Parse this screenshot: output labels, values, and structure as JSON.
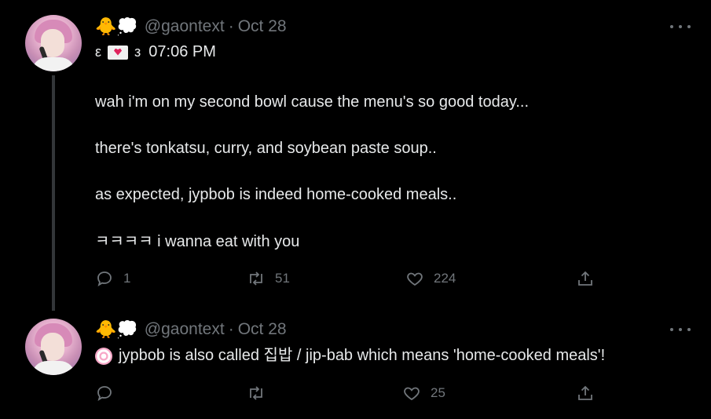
{
  "tweets": [
    {
      "display_emoji": "🐥💭",
      "handle": "@gaontext",
      "separator": "·",
      "date": "Oct 28",
      "time_line": {
        "left_bracket": "ε",
        "right_bracket": "з",
        "time": "07:06 PM"
      },
      "lines": [
        "wah i'm on my second bowl cause the menu's so good today...",
        "there's tonkatsu, curry, and soybean paste soup..",
        "as expected, jypbob is indeed home-cooked meals..",
        "ㅋㅋㅋㅋ i wanna eat with you"
      ],
      "replies": "1",
      "retweets": "51",
      "likes": "224"
    },
    {
      "display_emoji": "🐥💭",
      "handle": "@gaontext",
      "separator": "·",
      "date": "Oct 28",
      "text": "jypbob is also called 집밥 / jip-bab which means 'home-cooked meals'!",
      "replies": "",
      "retweets": "",
      "likes": "25"
    }
  ],
  "icons": {
    "reply": "reply-icon",
    "retweet": "retweet-icon",
    "like": "heart-icon",
    "share": "share-icon",
    "more": "more-icon"
  },
  "colors": {
    "background": "#000000",
    "text": "#e7e9ea",
    "secondary": "#71767b",
    "thread_line": "#333639"
  }
}
